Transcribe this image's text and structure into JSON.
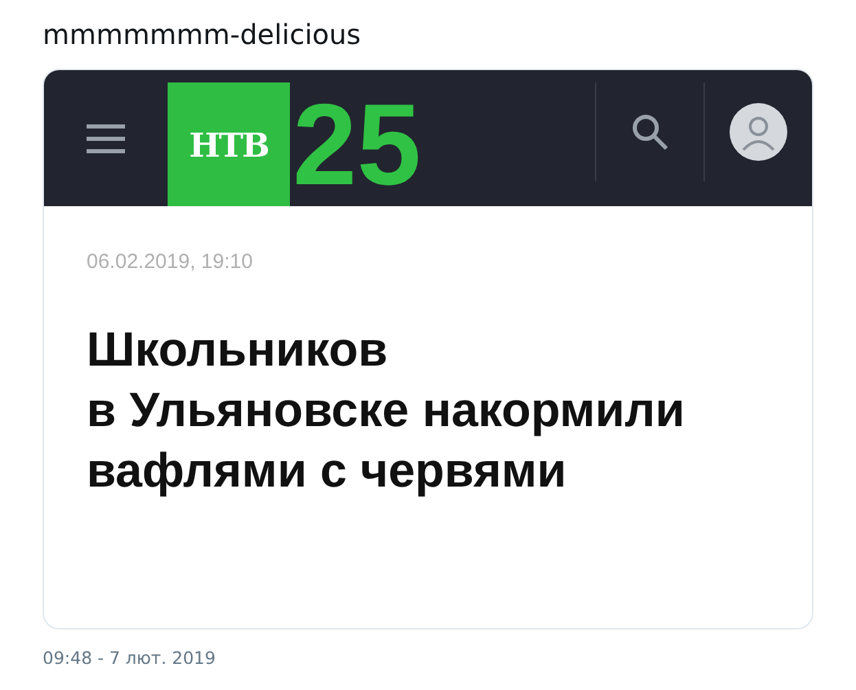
{
  "tweet_text": "mmmmmmm-delicious",
  "site_header": {
    "logo": {
      "mark": "НТВ",
      "number": "25"
    }
  },
  "article": {
    "date": "06.02.2019, 19:10",
    "headline_lines": [
      "Школьников",
      "в Ульяновске накормили",
      "вафлями с червями"
    ]
  },
  "timestamp": "09:48 - 7 лют. 2019"
}
